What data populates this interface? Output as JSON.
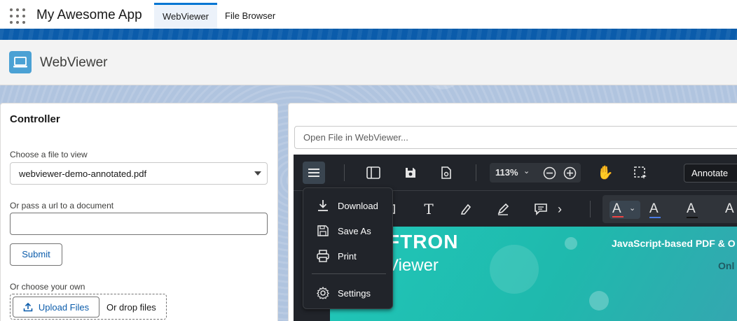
{
  "app": {
    "name": "My Awesome App"
  },
  "nav": {
    "tabs": [
      {
        "label": "WebViewer",
        "active": true
      },
      {
        "label": "File Browser",
        "active": false
      }
    ]
  },
  "header": {
    "title": "WebViewer",
    "icon": "laptop-icon"
  },
  "controller": {
    "title": "Controller",
    "file_label": "Choose a file to view",
    "file_value": "webviewer-demo-annotated.pdf",
    "url_label": "Or pass a url to a document",
    "url_value": "",
    "submit_label": "Submit",
    "own_label": "Or choose your own",
    "upload_label": "Upload Files",
    "drop_label": "Or drop files"
  },
  "viewer": {
    "open_placeholder": "Open File in WebViewer...",
    "zoom": "113%",
    "mode": "Annotate",
    "menu": [
      {
        "label": "Download",
        "icon": "download-icon"
      },
      {
        "label": "Save As",
        "icon": "save-icon"
      },
      {
        "label": "Print",
        "icon": "print-icon"
      },
      {
        "label": "Settings",
        "icon": "gear-icon"
      }
    ],
    "document": {
      "brand": "FTRON",
      "subtitle": "Viewer",
      "tagline": "JavaScript-based PDF & O",
      "tagline2": "Onl"
    }
  },
  "colors": {
    "accent": "#0176d3",
    "brand_bar": "#0b5cab",
    "viewer_bg": "#21242a",
    "doc_teal": "#20c7b8"
  }
}
